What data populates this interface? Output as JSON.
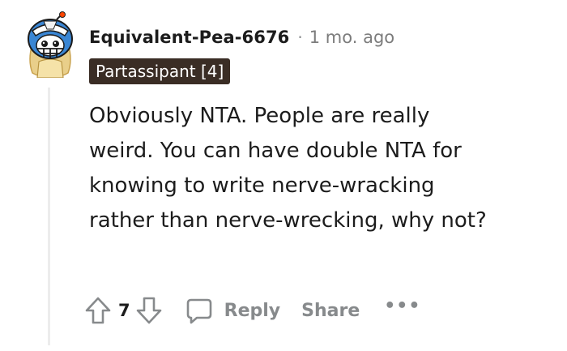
{
  "comment": {
    "author": "Equivalent-Pea-6676",
    "separator": "·",
    "timestamp": "1 mo. ago",
    "flair": "Partassipant [4]",
    "body": "Obviously NTA. People are really weird. You can have double NTA for knowing to write nerve-wracking rather than nerve-wrecking, why not?",
    "avatar_icon": "snoo-avatar-icon"
  },
  "actions": {
    "upvote_icon": "upvote-arrow-icon",
    "vote_count": "7",
    "downvote_icon": "downvote-arrow-icon",
    "reply_icon": "speech-bubble-icon",
    "reply_label": "Reply",
    "share_label": "Share",
    "more_label": "•••"
  },
  "colors": {
    "text": "#1c1c1c",
    "muted": "#878a8c",
    "flair_bg": "#3a2d25",
    "flair_text": "#ffffff",
    "thread_line": "#ececec"
  }
}
